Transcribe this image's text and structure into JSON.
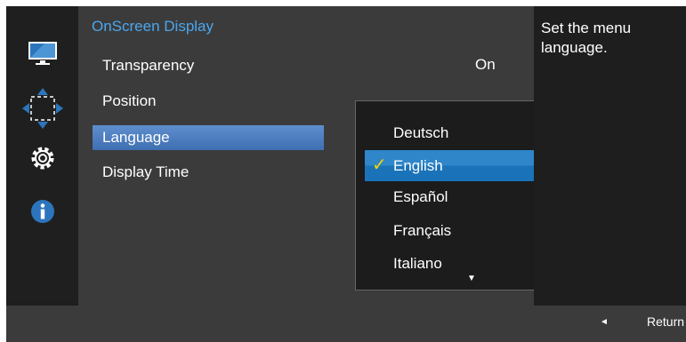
{
  "panel": {
    "title": "OnScreen Display",
    "items": [
      {
        "label": "Transparency",
        "value": "On"
      },
      {
        "label": "Position"
      },
      {
        "label": "Language"
      },
      {
        "label": "Display Time"
      }
    ]
  },
  "dropdown": {
    "options": [
      "Deutsch",
      "English",
      "Español",
      "Français",
      "Italiano"
    ],
    "selected": "English",
    "check_glyph": "✓",
    "more_glyph": "▼"
  },
  "help": {
    "text": "Set the menu language."
  },
  "footer": {
    "return_icon": "◄",
    "return_label": "Return"
  },
  "icons": {
    "rail": [
      "monitor-icon",
      "move-arrows-icon",
      "gear-icon",
      "info-icon"
    ]
  },
  "colors": {
    "accent": "#4aa6ef",
    "highlight": "#3e6fb2",
    "dropdown_highlight": "#2f86c9",
    "check": "#f2d400"
  }
}
